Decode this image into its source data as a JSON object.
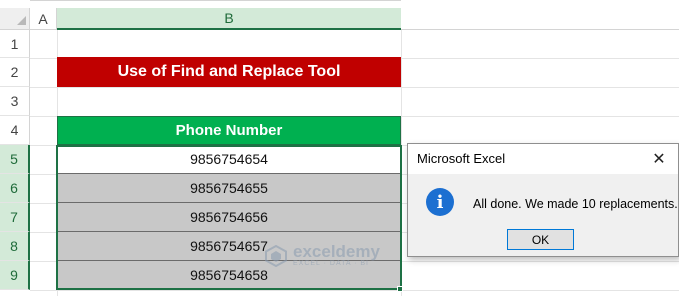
{
  "sheet": {
    "columns": [
      "A",
      "B"
    ],
    "rows": [
      "1",
      "2",
      "3",
      "4",
      "5",
      "6",
      "7",
      "8",
      "9"
    ]
  },
  "title": "Use of Find and Replace Tool",
  "table": {
    "header": "Phone Number",
    "values": [
      "9856754654",
      "9856754655",
      "9856754656",
      "9856754657",
      "9856754658"
    ]
  },
  "watermark": {
    "name": "exceldemy",
    "tagline": "EXCEL · DATA · BI"
  },
  "dialog": {
    "title": "Microsoft Excel",
    "close": "✕",
    "icon": "i",
    "message": "All done. We made 10 replacements.",
    "ok_label": "OK"
  },
  "colors": {
    "title_bg": "#c00000",
    "header_bg": "#00b050",
    "selection": "#1e7145",
    "info_icon": "#1c6fd1"
  }
}
